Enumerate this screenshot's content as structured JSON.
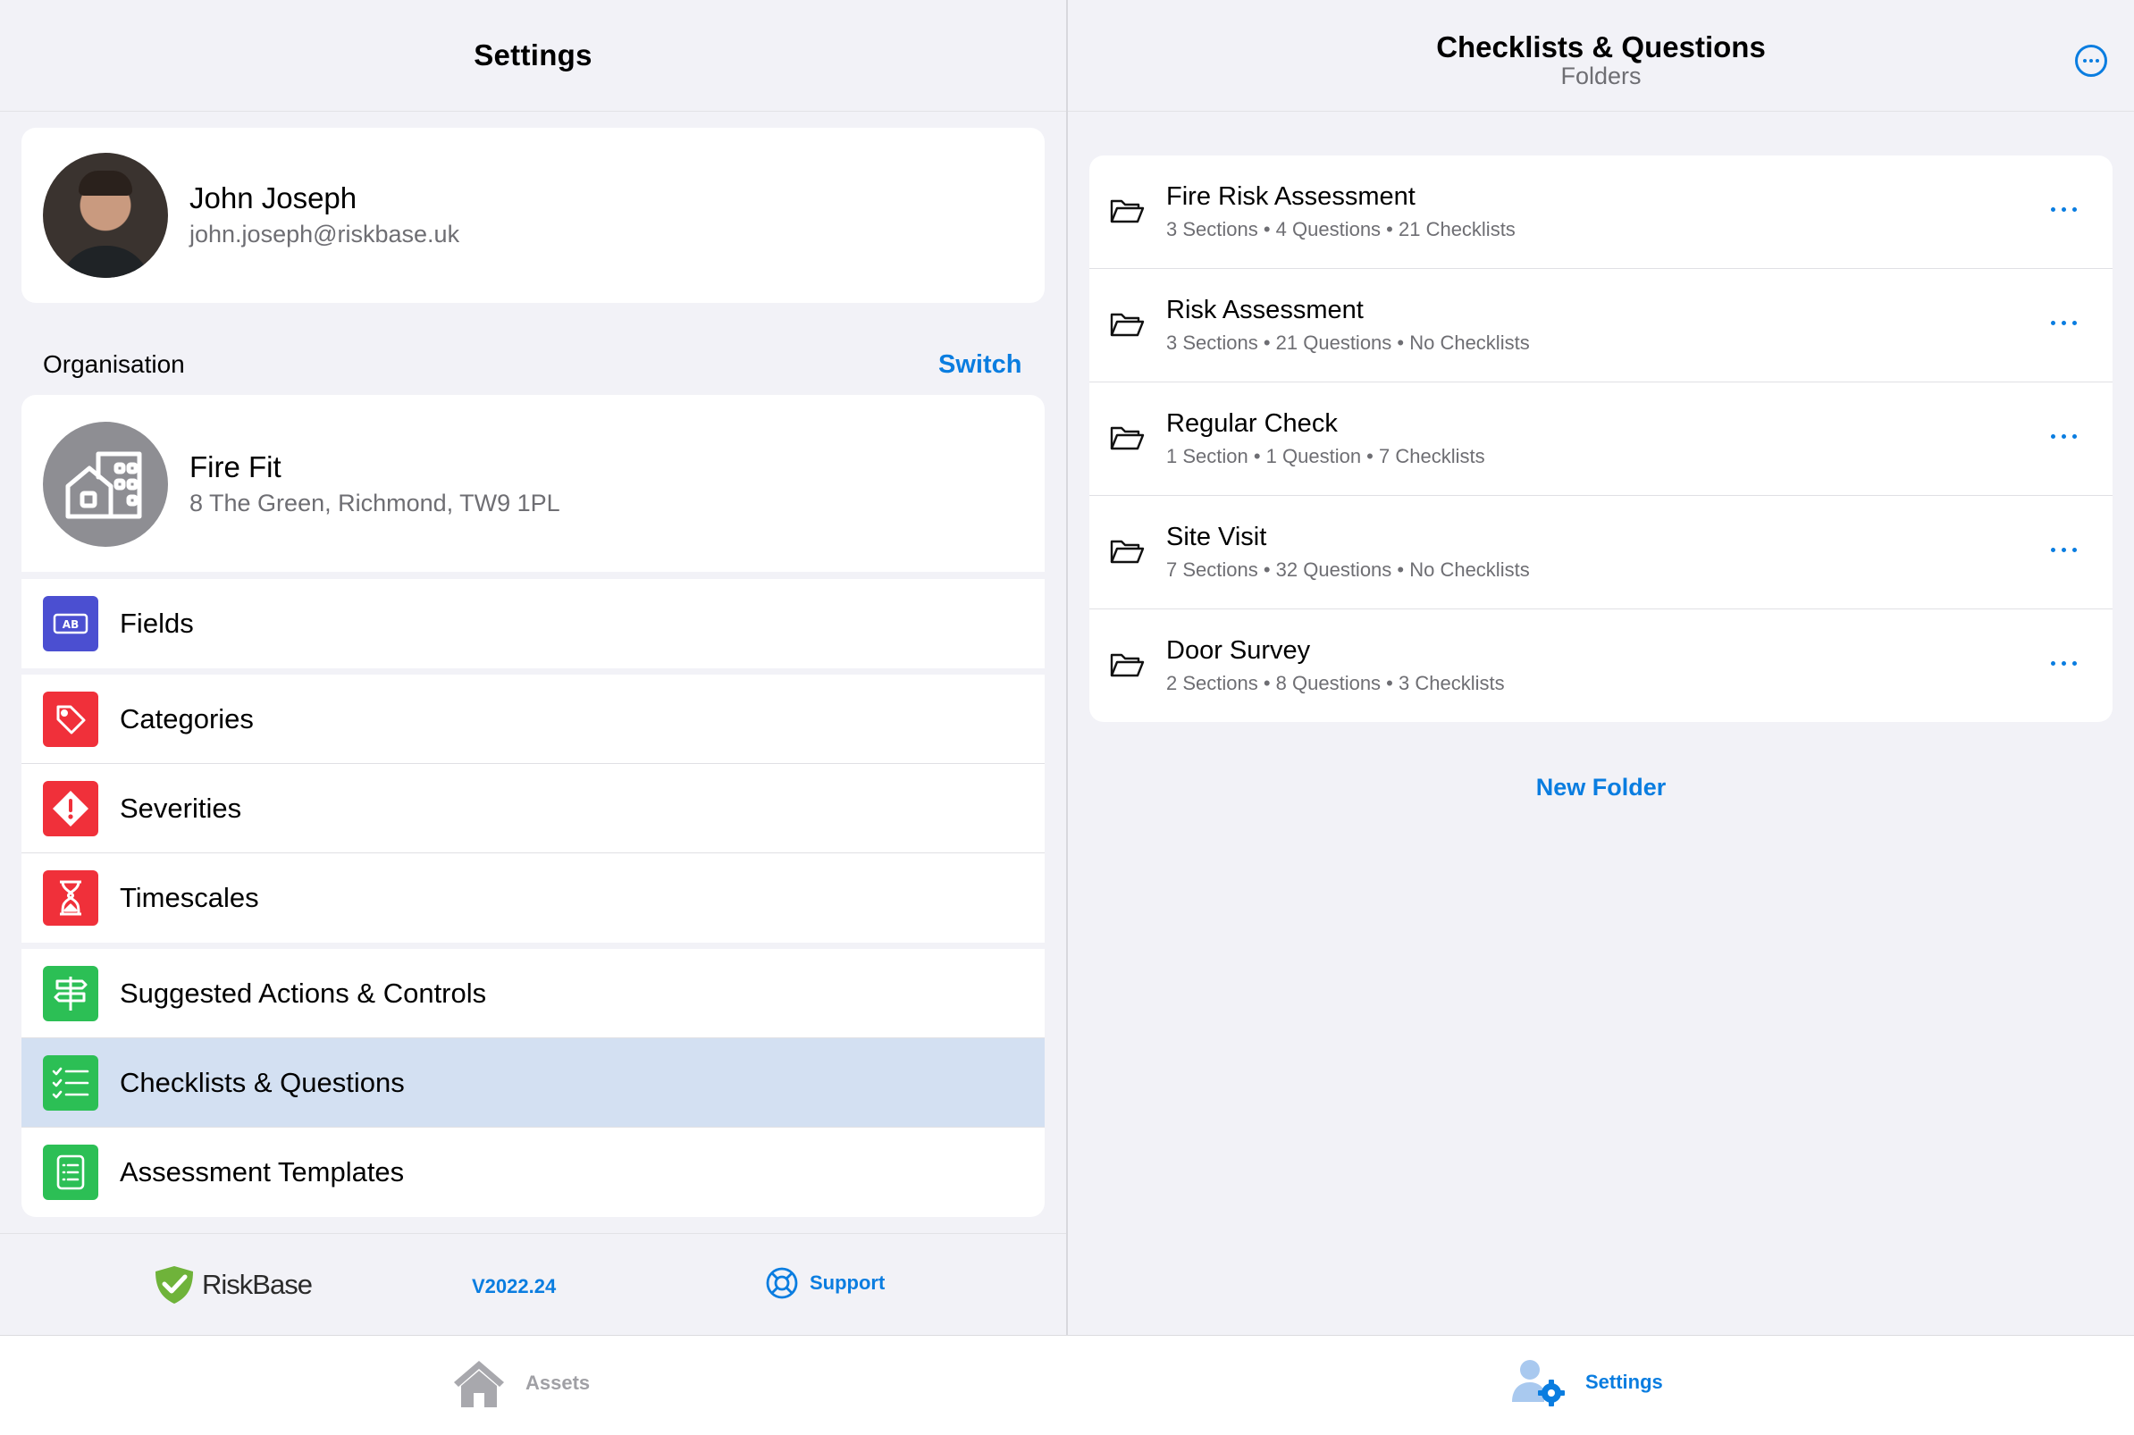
{
  "left_header": {
    "title": "Settings"
  },
  "profile": {
    "name": "John Joseph",
    "email": "john.joseph@riskbase.uk"
  },
  "organisation": {
    "section_label": "Organisation",
    "switch_label": "Switch",
    "name": "Fire Fit",
    "address": "8 The Green, Richmond, TW9 1PL"
  },
  "menu": {
    "fields": "Fields",
    "categories": "Categories",
    "severities": "Severities",
    "timescales": "Timescales",
    "suggested_actions": "Suggested Actions & Controls",
    "checklists": "Checklists & Questions",
    "templates": "Assessment Templates",
    "fields_icon_text": "AB"
  },
  "footer": {
    "brand": "RiskBase",
    "version": "V2022.24",
    "support": "Support"
  },
  "right_header": {
    "title": "Checklists & Questions",
    "subtitle": "Folders"
  },
  "folders": [
    {
      "name": "Fire Risk Assessment",
      "meta": "3 Sections • 4 Questions • 21 Checklists"
    },
    {
      "name": "Risk Assessment",
      "meta": "3 Sections • 21 Questions • No Checklists"
    },
    {
      "name": "Regular Check",
      "meta": "1 Section • 1 Question • 7 Checklists"
    },
    {
      "name": "Site Visit",
      "meta": "7 Sections • 32 Questions • No Checklists"
    },
    {
      "name": "Door Survey",
      "meta": "2 Sections • 8 Questions • 3 Checklists"
    }
  ],
  "new_folder": "New Folder",
  "tabs": {
    "assets": "Assets",
    "settings": "Settings"
  },
  "colors": {
    "accent": "#0a7de0",
    "selected_row": "#d3e0f2",
    "fields_icon": "#4b4fd1",
    "red_icon": "#f0303a",
    "green_icon": "#2cbf55"
  }
}
